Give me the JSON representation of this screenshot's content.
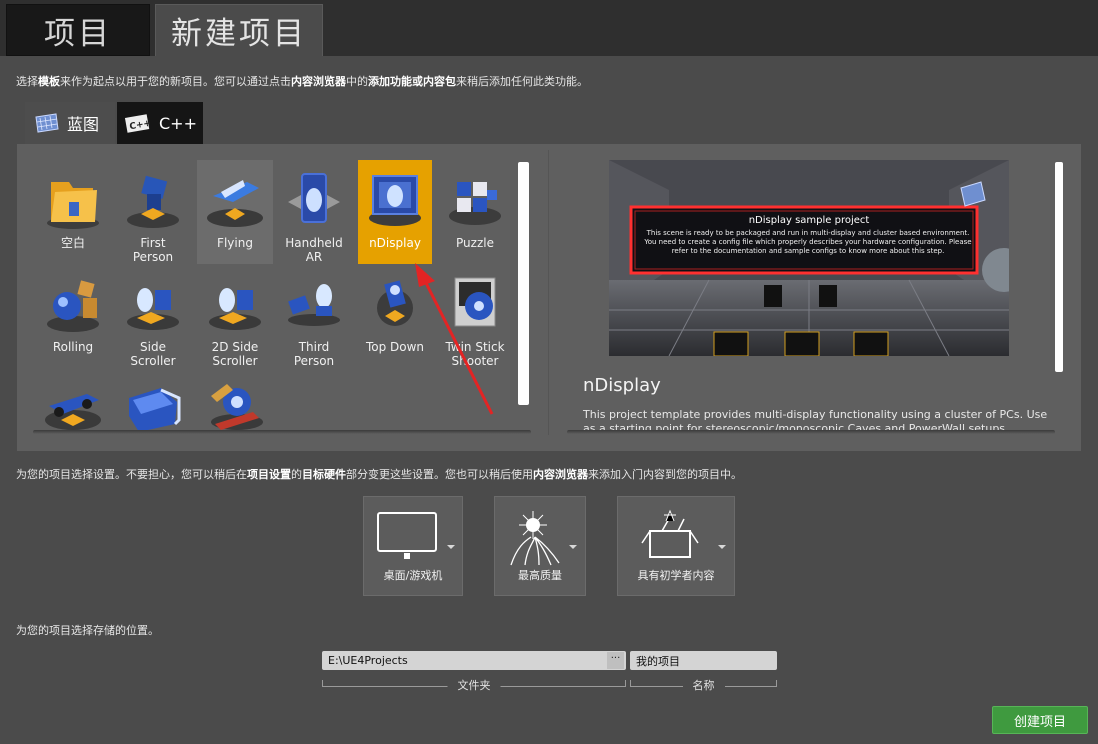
{
  "tabs": {
    "projects": "项目",
    "new_project": "新建项目"
  },
  "intro": {
    "a": "选择",
    "b": "模板",
    "c": "来作为起点以用于您的新项目。您可以通过点击",
    "d": "内容浏览器",
    "e": "中的",
    "f": "添加功能或内容包",
    "g": "来稍后添加任何此类功能。"
  },
  "lang_tabs": {
    "blueprint": "蓝图",
    "cpp": "C++"
  },
  "templates": [
    {
      "label": "空白",
      "icon": "folder-icon"
    },
    {
      "label": "First\nPerson",
      "icon": "first-person-icon"
    },
    {
      "label": "Flying",
      "icon": "flying-icon"
    },
    {
      "label": "Handheld\nAR",
      "icon": "handheld-ar-icon"
    },
    {
      "label": "nDisplay",
      "icon": "ndisplay-icon"
    },
    {
      "label": "Puzzle",
      "icon": "puzzle-icon"
    },
    {
      "label": "Rolling",
      "icon": "rolling-icon"
    },
    {
      "label": "Side\nScroller",
      "icon": "side-scroller-icon"
    },
    {
      "label": "2D Side\nScroller",
      "icon": "2d-side-scroller-icon"
    },
    {
      "label": "Third\nPerson",
      "icon": "third-person-icon"
    },
    {
      "label": "Top Down",
      "icon": "top-down-icon"
    },
    {
      "label": "Twin Stick\nShooter",
      "icon": "twin-stick-icon"
    },
    {
      "label": "",
      "icon": "vehicle-icon"
    },
    {
      "label": "",
      "icon": "vr-icon"
    },
    {
      "label": "",
      "icon": "vehicle-advanced-icon"
    }
  ],
  "selected_template": "nDisplay",
  "preview": {
    "title": "nDisplay",
    "description": "This project template provides multi-display functionality using a cluster of PCs. Use as a starting point for stereoscopic/monoscopic Caves and PowerWall setups.",
    "image_heading": "nDisplay sample project",
    "image_text": "This scene is ready to be packaged and run in multi-display and cluster based environment. You need to create a config file which properly describes your hardware configuration. Please refer to the documentation and sample configs to know more about this step."
  },
  "settings_hint": {
    "a": "为您的项目选择设置。不要担心，您可以稍后在",
    "b": "项目设置",
    "c": "的",
    "d": "目标硬件",
    "e": "部分变更这些设置。您也可以稍后使用",
    "f": "内容浏览器",
    "g": "来添加入门内容到您的项目中。"
  },
  "settings": {
    "hardware": "桌面/游戏机",
    "quality": "最高质量",
    "content": "具有初学者内容"
  },
  "location": {
    "hint": "为您的项目选择存储的位置。",
    "folder_value": "E:\\UE4Projects",
    "browse": "···",
    "folder_label": "文件夹",
    "name_value": "我的项目",
    "name_label": "名称"
  },
  "create_button": "创建项目"
}
